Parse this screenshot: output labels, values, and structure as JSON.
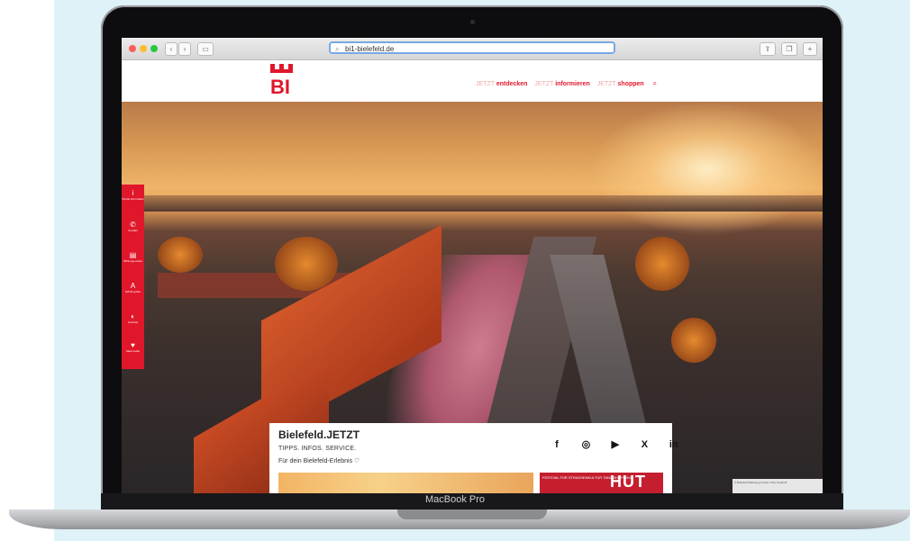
{
  "browser": {
    "url": "bi1-bielefeld.de",
    "controls": {
      "back": "‹",
      "forward": "›"
    }
  },
  "site": {
    "logo_text": "BI",
    "nav": [
      {
        "prefix": "JETZT",
        "word": "entdecken"
      },
      {
        "prefix": "JETZT",
        "word": "informieren"
      },
      {
        "prefix": "JETZT",
        "word": "shoppen"
      }
    ],
    "sidebar": [
      {
        "icon": "i",
        "label": "Tourist Information"
      },
      {
        "icon": "✆",
        "label": "Kontakt"
      },
      {
        "icon": "▤",
        "label": "Öffnungs-zeiten"
      },
      {
        "icon": "A",
        "label": "Schrift-größe"
      },
      {
        "icon": "◐",
        "label": "Kontrast"
      },
      {
        "icon": "♥",
        "label": "Merk-zettel"
      }
    ],
    "card": {
      "title": "Bielefeld.JETZT",
      "subtitle": "TIPPS. INFOS. SERVICE.",
      "text": "Für dein Bielefeld-Erlebnis ♡",
      "socials": [
        "f",
        "◎",
        "▶",
        "X",
        "in"
      ],
      "promo_small": "FESTIVAL FÜR STRASSENKULTUR TANZ SHOPPING",
      "promo_big": "HUT"
    },
    "credit": "© Bielefeld Marketing GmbH / Max Kerkhoff"
  },
  "device": {
    "label": "MacBook Pro"
  }
}
